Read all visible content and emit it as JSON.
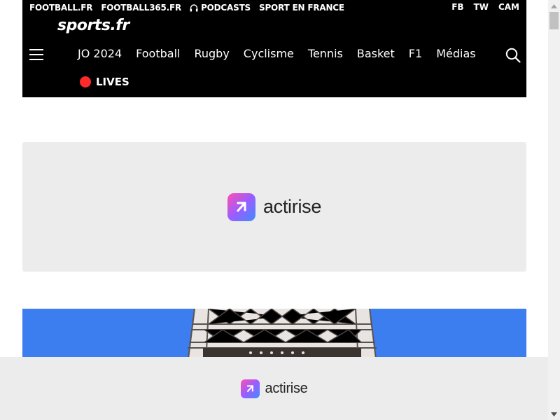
{
  "header": {
    "top_links": [
      "FOOTBALL.FR",
      "FOOTBALL365.FR",
      "PODCASTS",
      "SPORT EN FRANCE"
    ],
    "social": [
      "FB",
      "TW",
      "CAM"
    ],
    "logo": "sports.fr",
    "nav": [
      "JO 2024",
      "Football",
      "Rugby",
      "Cyclisme",
      "Tennis",
      "Basket",
      "F1",
      "Médias"
    ],
    "lives_label": "LIVES",
    "icons": {
      "menu": "hamburger-menu-icon",
      "search": "search-icon",
      "podcast": "headphones-icon"
    }
  },
  "ad_banner": {
    "brand": "actirise"
  },
  "sticky_ad": {
    "brand": "actirise"
  },
  "colors": {
    "header_bg": "#000000",
    "live_dot": "#ff2b2b",
    "ad_bg": "#ececec",
    "sky": "#3c7df0"
  }
}
